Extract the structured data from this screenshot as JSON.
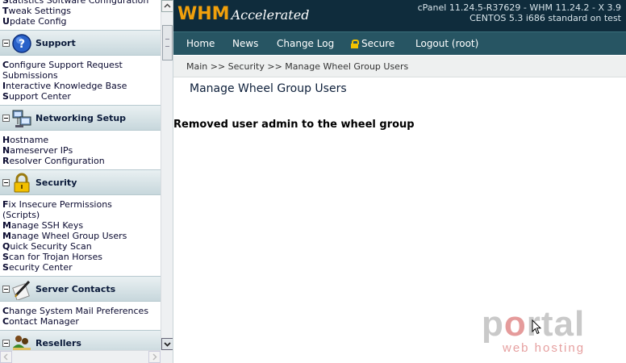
{
  "sidebar": {
    "top_links": [
      {
        "first": "S",
        "rest": "tatistics Software Configuration"
      },
      {
        "first": "T",
        "rest": "weak Settings"
      },
      {
        "first": "U",
        "rest": "pdate Config"
      }
    ],
    "sections": [
      {
        "title": "Support",
        "icon": "support-question-icon",
        "links": [
          {
            "first": "C",
            "rest": "onfigure Support Request"
          },
          {
            "first": "",
            "rest": "Submissions"
          },
          {
            "first": "I",
            "rest": "nteractive Knowledge Base"
          },
          {
            "first": "S",
            "rest": "upport Center"
          }
        ]
      },
      {
        "title": "Networking Setup",
        "icon": "networking-computer-icon",
        "links": [
          {
            "first": "H",
            "rest": "ostname"
          },
          {
            "first": "N",
            "rest": "ameserver IPs"
          },
          {
            "first": "R",
            "rest": "esolver Configuration"
          }
        ]
      },
      {
        "title": "Security",
        "icon": "security-lock-icon",
        "links": [
          {
            "first": "F",
            "rest": "ix Insecure Permissions"
          },
          {
            "first": "",
            "rest": "(Scripts)"
          },
          {
            "first": "M",
            "rest": "anage SSH Keys"
          },
          {
            "first": "M",
            "rest": "anage Wheel Group Users"
          },
          {
            "first": "Q",
            "rest": "uick Security Scan"
          },
          {
            "first": "S",
            "rest": "can for Trojan Horses"
          },
          {
            "first": "S",
            "rest": "ecurity Center"
          }
        ]
      },
      {
        "title": "Server Contacts",
        "icon": "server-contacts-pen-icon",
        "links": [
          {
            "first": "C",
            "rest": "hange System Mail Preferences"
          },
          {
            "first": "C",
            "rest": "ontact Manager"
          }
        ]
      },
      {
        "title": "Resellers",
        "icon": "resellers-people-icon",
        "links": []
      }
    ]
  },
  "header": {
    "logo_main": "WHM",
    "logo_sub": "Accelerated",
    "version_line1": "cPanel 11.24.5-R37629 - WHM 11.24.2 - X 3.9",
    "version_line2": "CENTOS 5.3 i686 standard on test"
  },
  "nav": {
    "home": "Home",
    "news": "News",
    "changelog": "Change Log",
    "secure": "Secure",
    "logout": "Logout (root)"
  },
  "breadcrumb": "Main >> Security >> Manage Wheel Group Users",
  "page_title": "Manage Wheel Group Users",
  "message": "Removed user admin to the wheel group",
  "watermark": {
    "big": "portal",
    "small": "web hosting"
  }
}
